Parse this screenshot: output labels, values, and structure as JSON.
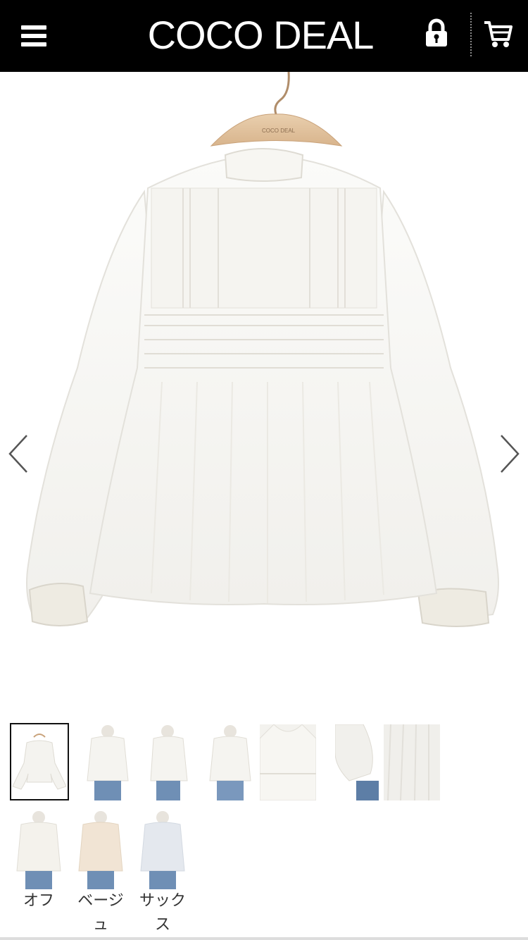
{
  "header": {
    "logo": "COCO DEAL",
    "menu_icon": "hamburger-menu-icon",
    "lock_icon": "lock-icon",
    "cart_icon": "cart-icon",
    "background": "#000000"
  },
  "gallery": {
    "main_image": "white-lace-blouse-on-hanger",
    "hanger_text": "COCO DEAL",
    "prev_icon": "chevron-left-icon",
    "next_icon": "chevron-right-icon",
    "thumbnails": [
      {
        "subject": "blouse-on-hanger",
        "selected": true
      },
      {
        "subject": "model-front"
      },
      {
        "subject": "model-side"
      },
      {
        "subject": "model-back"
      },
      {
        "subject": "neck-detail"
      },
      {
        "subject": "sleeve-detail"
      },
      {
        "subject": "hem-detail"
      }
    ]
  },
  "colors": [
    {
      "label": "オフ",
      "swatch": "#f4f2ec"
    },
    {
      "label": "ベージュ",
      "swatch": "#f1e4d4"
    },
    {
      "label": "サックス",
      "swatch": "#e4e8ee"
    }
  ]
}
